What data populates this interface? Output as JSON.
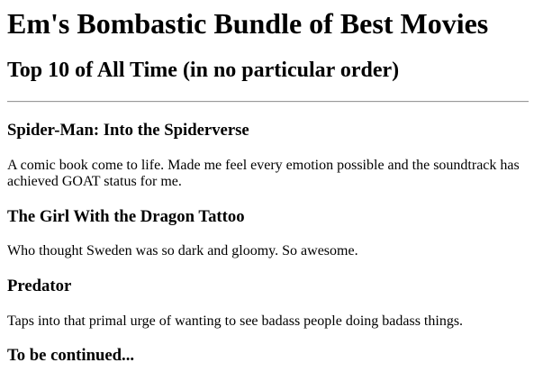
{
  "page": {
    "title": "Em's Bombastic Bundle of Best Movies",
    "subtitle": "Top 10 of All Time (in no particular order)"
  },
  "movies": [
    {
      "title": "Spider-Man: Into the Spiderverse",
      "description": "A comic book come to life. Made me feel every emotion possible and the soundtrack has achieved GOAT status for me."
    },
    {
      "title": "The Girl With the Dragon Tattoo",
      "description": "Who thought Sweden was so dark and gloomy. So awesome."
    },
    {
      "title": "Predator",
      "description": "Taps into that primal urge of wanting to see badass people doing badass things."
    }
  ],
  "footer_heading": "To be continued..."
}
